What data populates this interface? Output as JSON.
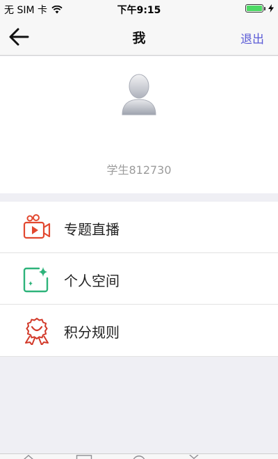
{
  "status_bar": {
    "carrier": "无 SIM 卡",
    "time": "下午9:15",
    "battery_percent": 100,
    "icons": [
      "wifi-icon",
      "battery-icon",
      "charging-bolt-icon"
    ]
  },
  "nav": {
    "title": "我",
    "logout_label": "退出",
    "back_icon": "arrow-left-icon",
    "accent_color": "#5b5bd6"
  },
  "profile": {
    "username": "学生812730",
    "avatar_icon": "default-avatar-icon"
  },
  "menu": {
    "items": [
      {
        "label": "专题直播",
        "icon": "video-camera-icon",
        "color": "#e2482f"
      },
      {
        "label": "个人空间",
        "icon": "sparkle-frame-icon",
        "color": "#2db37a"
      },
      {
        "label": "积分规则",
        "icon": "award-ribbon-icon",
        "color": "#d23a2a"
      }
    ]
  },
  "tab_bar": {
    "icons": [
      "home-icon",
      "book-icon",
      "compass-icon",
      "profile-icon"
    ]
  }
}
